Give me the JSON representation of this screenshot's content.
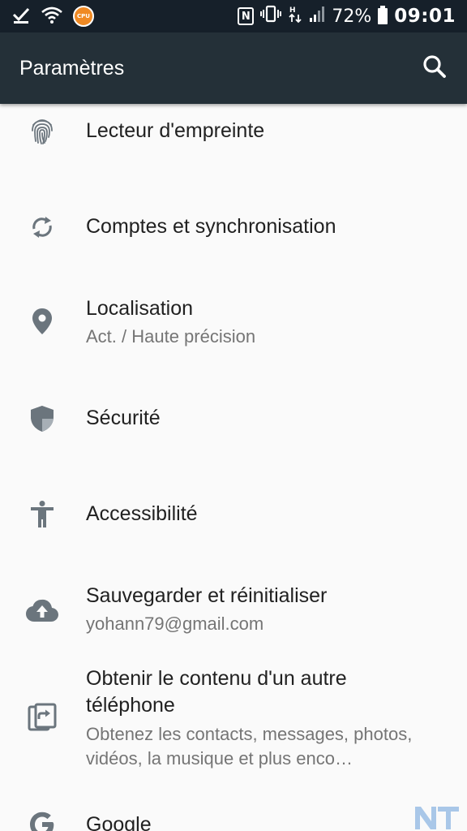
{
  "status_bar": {
    "cpu_badge": "CPU",
    "nfc": "N",
    "battery_pct": "72%",
    "time": "09:01",
    "icons": [
      "checkmark-icon",
      "wifi-icon",
      "cpu-badge-icon",
      "nfc-icon",
      "vibrate-icon",
      "data-arrows-icon",
      "signal-icon",
      "battery-icon"
    ]
  },
  "app_bar": {
    "title": "Paramètres",
    "search_icon": "search-icon"
  },
  "settings": {
    "items": [
      {
        "title": "Lecteur d'empreinte",
        "subtitle": "",
        "icon": "fingerprint-icon"
      },
      {
        "title": "Comptes et synchronisation",
        "subtitle": "",
        "icon": "sync-icon"
      },
      {
        "title": "Localisation",
        "subtitle": "Act. / Haute précision",
        "icon": "location-pin-icon"
      },
      {
        "title": "Sécurité",
        "subtitle": "",
        "icon": "shield-icon"
      },
      {
        "title": "Accessibilité",
        "subtitle": "",
        "icon": "accessibility-icon"
      },
      {
        "title": "Sauvegarder et réinitialiser",
        "subtitle": "yohann79@gmail.com",
        "icon": "cloud-upload-icon"
      },
      {
        "title": "Obtenir le contenu d'un autre téléphone",
        "subtitle": "Obtenez les contacts, messages, photos, vidéos, la musique et plus enco…",
        "icon": "transfer-icon"
      },
      {
        "title": "Google",
        "subtitle": "",
        "icon": "google-icon"
      }
    ]
  },
  "colors": {
    "status_bar_bg": "#16202a",
    "app_bar_bg": "#243038",
    "background": "#fafafa",
    "icon_gray": "#6b757d",
    "title_text": "#212121",
    "subtitle_text": "#757575",
    "watermark_blue": "#a9c7e8"
  }
}
